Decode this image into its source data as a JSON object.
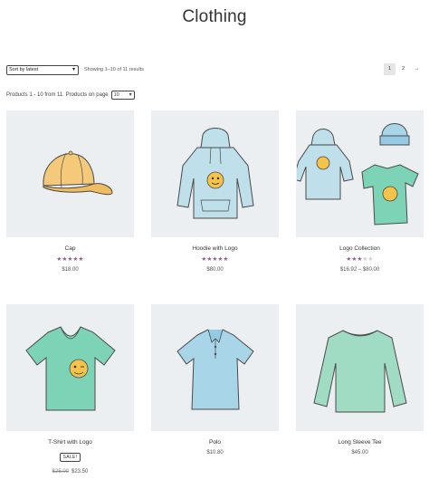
{
  "page": {
    "title": "Clothing"
  },
  "toolbar": {
    "sort_value": "Sort by latest",
    "result_count": "Showing 1–10 of 11 results",
    "pagination": [
      "1",
      "2",
      "→"
    ],
    "per_page_prefix": "Products 1 - 10 from 11. Products on page",
    "per_page_value": "10"
  },
  "colors": {
    "accent": "#96588a",
    "thumb_bg": "#eceff2"
  },
  "products": [
    {
      "name": "Cap",
      "rating": 5,
      "stars": "★★★★★",
      "price": "$18.00",
      "icon": "cap-icon"
    },
    {
      "name": "Hoodie with Logo",
      "rating": 5,
      "stars": "★★★★★",
      "price": "$80.00",
      "icon": "hoodie-icon"
    },
    {
      "name": "Logo Collection",
      "rating": 3,
      "stars_on": "★★★",
      "stars_off": "★★",
      "price": "$16.92 – $80.00",
      "icon": "logo-collection-icon"
    },
    {
      "name": "T-Shirt with Logo",
      "badge": "SALE!",
      "old_price": "$25.00",
      "price": "$23.50",
      "icon": "tshirt-icon"
    },
    {
      "name": "Polo",
      "price": "$10.80",
      "icon": "polo-icon"
    },
    {
      "name": "Long Sleeve Tee",
      "price": "$45.00",
      "icon": "long-sleeve-icon"
    }
  ]
}
